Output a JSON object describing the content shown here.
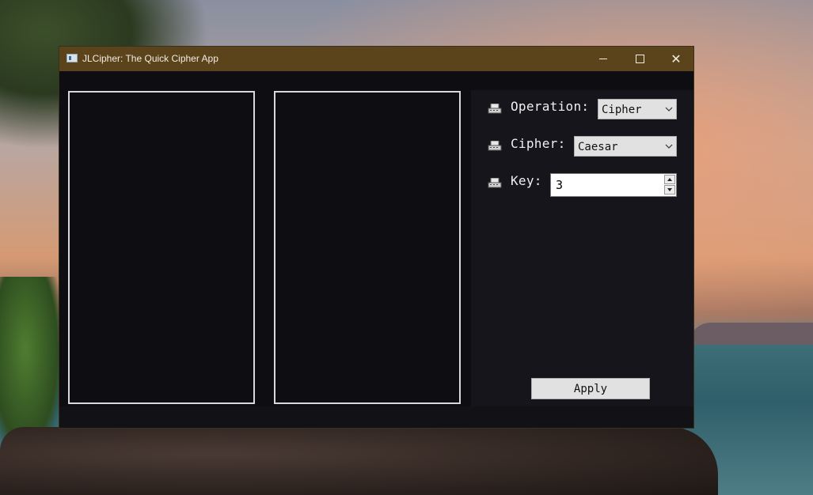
{
  "window": {
    "title": "JLCipher: The Quick Cipher App",
    "controls": {
      "minimize_icon": "minimize-icon",
      "maximize_icon": "maximize-icon",
      "close_icon": "close-icon"
    }
  },
  "panels": {
    "input_text": "",
    "output_text": ""
  },
  "settings": {
    "operation": {
      "label": "Operation:",
      "value": "Cipher",
      "icon": "keyboard-icon"
    },
    "cipher": {
      "label": "Cipher:",
      "value": "Caesar",
      "icon": "keyboard-icon"
    },
    "key": {
      "label": "Key:",
      "value": "3",
      "icon": "keyboard-icon"
    },
    "apply_label": "Apply"
  },
  "colors": {
    "titlebar": "#5b431c",
    "window_bg": "#0e0d12",
    "side_bg": "#16151b",
    "panel_border": "#d9d9d9"
  }
}
